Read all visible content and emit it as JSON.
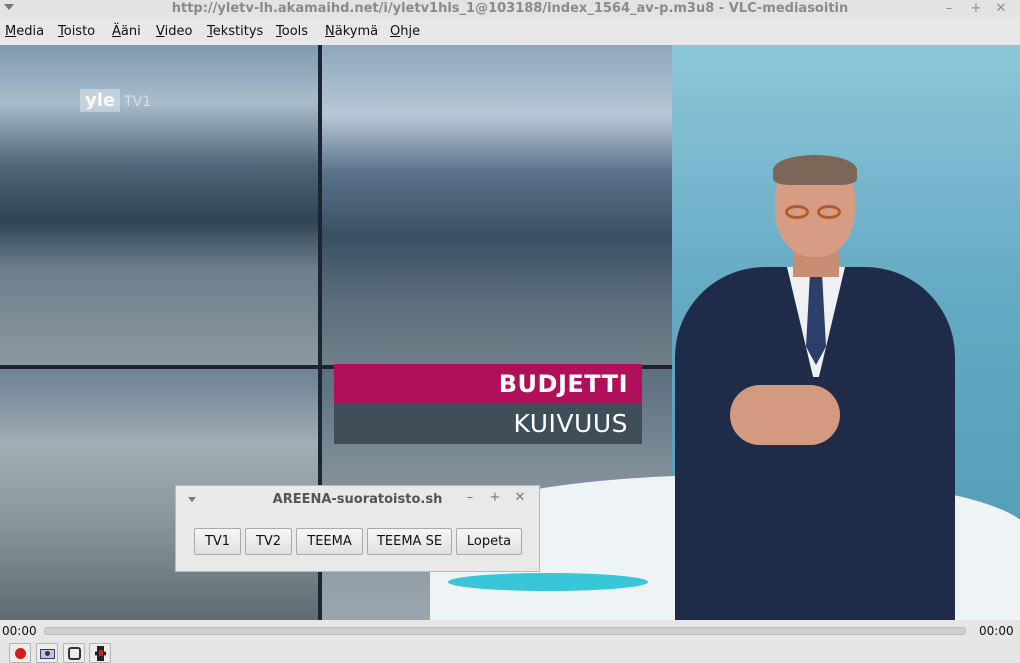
{
  "window": {
    "title": "http://yletv-lh.akamaihd.net/i/yletv1hls_1@103188/index_1564_av-p.m3u8 - VLC-mediasoitin",
    "minimize": "–",
    "maximize": "+",
    "close": "✕"
  },
  "menubar": {
    "items": [
      {
        "underline": "M",
        "rest": "edia"
      },
      {
        "underline": "T",
        "rest": "oisto"
      },
      {
        "underline": "Ä",
        "rest": "äni"
      },
      {
        "underline": "V",
        "rest": "ideo"
      },
      {
        "underline": "T",
        "rest": "ekstitys"
      },
      {
        "underline": "T",
        "rest": "ools"
      },
      {
        "underline": "N",
        "rest": "äkymä"
      },
      {
        "underline": "O",
        "rest": "hje"
      }
    ]
  },
  "video": {
    "logo_brand": "yle",
    "logo_channel": "TV1",
    "headline": "BUDJETTI",
    "subline": "KUIVUUS",
    "headline_color": "#b0105a"
  },
  "dialog": {
    "title": "AREENA-suoratoisto.sh",
    "minimize": "–",
    "maximize": "+",
    "close": "✕",
    "buttons": [
      "TV1",
      "TV2",
      "TEEMA",
      "TEEMA SE",
      "Lopeta"
    ]
  },
  "controls": {
    "elapsed": "00:00",
    "total": "00:00",
    "progress": 0,
    "record_color": "#d51b1b"
  },
  "icons": [
    "menu-arrow-icon",
    "record-icon",
    "snapshot-icon",
    "loop-icon",
    "frame-step-icon"
  ]
}
